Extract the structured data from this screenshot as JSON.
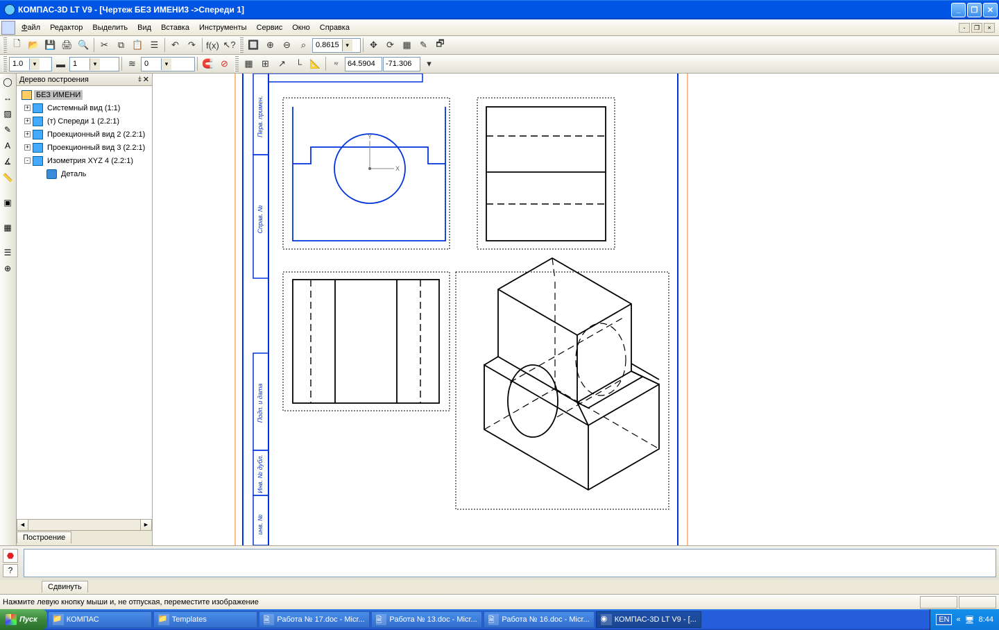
{
  "titlebar": {
    "text": "КОМПАС-3D LT V9 - [Чертеж БЕЗ ИМЕНИ3 ->Спереди 1]"
  },
  "menu": {
    "items": [
      "Файл",
      "Редактор",
      "Выделить",
      "Вид",
      "Вставка",
      "Инструменты",
      "Сервис",
      "Окно",
      "Справка"
    ]
  },
  "toolbar1": {
    "zoom_value": "0.8615"
  },
  "toolbar2": {
    "width_value": "1.0",
    "style_value": "1",
    "layer_value": "0",
    "coord_x": "64.5904",
    "coord_y": "-71.306"
  },
  "tree": {
    "title": "Дерево построения",
    "root": "БЕЗ ИМЕНИ",
    "nodes": [
      {
        "label": "Системный вид (1:1)"
      },
      {
        "label": "(т) Спереди 1 (2.2:1)"
      },
      {
        "label": "Проекционный вид 2 (2.2:1)"
      },
      {
        "label": "Проекционный вид 3 (2.2:1)"
      },
      {
        "label": "Изометрия XYZ 4 (2.2:1)"
      }
    ],
    "child": "Деталь",
    "tab": "Построение"
  },
  "cmd": {
    "tab": "Сдвинуть"
  },
  "status": {
    "text": "Нажмите левую кнопку мыши и, не отпуская, переместите изображение"
  },
  "taskbar": {
    "start": "Пуск",
    "items": [
      "КОМПАС",
      "Templates",
      "Работа № 17.doc - Micr...",
      "Работа № 13.doc - Micr...",
      "Работа № 16.doc - Micr...",
      "КОМПАС-3D LT V9 - [..."
    ],
    "lang": "EN",
    "time": "8:44"
  },
  "frame_labels": {
    "l1": "Перв. примен.",
    "l2": "Справ. №",
    "l3": "Подп. и дата",
    "l4": "Инв. № дубл.",
    "l5": "инв. №"
  }
}
